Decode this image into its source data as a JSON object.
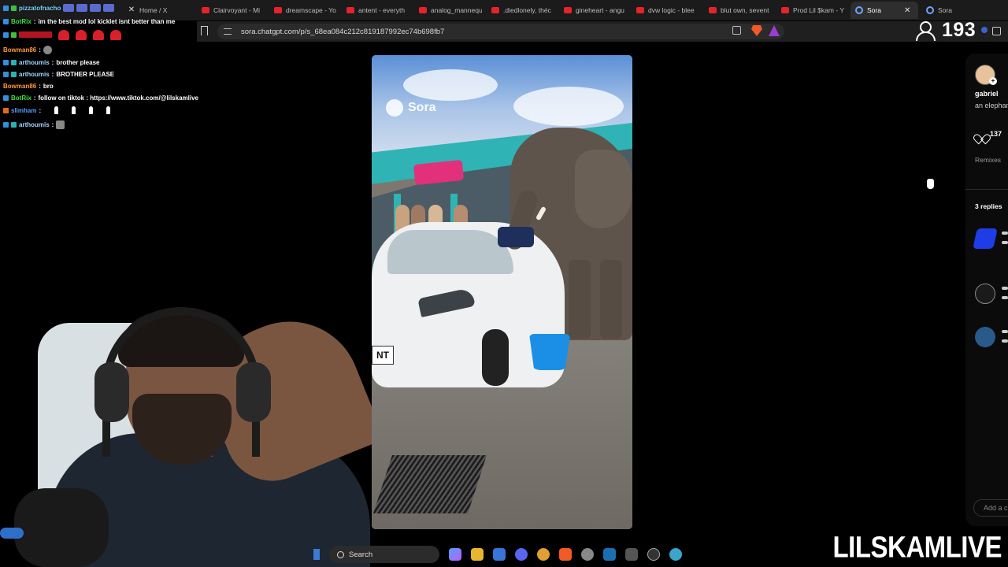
{
  "tabs": [
    {
      "label": "Home / X",
      "icon": "x-icon"
    },
    {
      "label": "Clairvoyant - Mi",
      "icon": "youtube-icon"
    },
    {
      "label": "dreamscape - Yo",
      "icon": "youtube-icon"
    },
    {
      "label": "antent - everyth",
      "icon": "youtube-icon"
    },
    {
      "label": "analog_mannequ",
      "icon": "youtube-icon"
    },
    {
      "label": ".diedlonely, théc",
      "icon": "youtube-icon"
    },
    {
      "label": "gineheart - angu",
      "icon": "youtube-icon"
    },
    {
      "label": "dvw logic - blee",
      "icon": "youtube-icon"
    },
    {
      "label": "blut own, sevent",
      "icon": "youtube-icon"
    },
    {
      "label": "Prod Lil $kam - Y",
      "icon": "youtube-icon"
    },
    {
      "label": "Sora",
      "icon": "sora-icon",
      "active": true
    },
    {
      "label": "Sora",
      "icon": "sora-icon"
    }
  ],
  "address": {
    "url": "sora.chatgpt.com/p/s_68ea084c212c819187992ec74b698fb7"
  },
  "viewers": {
    "count": "193"
  },
  "chat": [
    {
      "user": "pizzatofnacho",
      "msg": "",
      "user_color": "#7ad7ff"
    },
    {
      "user": "BotRix",
      "msg": "im the best mod lol kicklet isnt better than me",
      "user_color": "#3fe03f"
    },
    {
      "user": "",
      "msg": "",
      "user_color": "#d8202a"
    },
    {
      "user": "Bowman86",
      "msg": "",
      "user_color": "#ff9a3c"
    },
    {
      "user": "arthoumis",
      "msg": "brother please",
      "user_color": "#9fd6ff"
    },
    {
      "user": "arthoumis",
      "msg": "BROTHER PLEASE",
      "user_color": "#9fd6ff"
    },
    {
      "user": "Bowman86",
      "msg": "bro",
      "user_color": "#ff9a3c"
    },
    {
      "user": "BotRix",
      "msg": "follow on tiktok : https://www.tiktok.com/@lilskamlive",
      "user_color": "#3fe03f"
    },
    {
      "user": "slimham",
      "msg": "",
      "user_color": "#5b9cff"
    },
    {
      "user": "arthoumis",
      "msg": "",
      "user_color": "#9fd6ff"
    }
  ],
  "video": {
    "watermark": "Sora",
    "plate": "NT"
  },
  "sora_panel": {
    "username": "gabriel",
    "caption": "an elephant cleaning c",
    "likes": "137",
    "remixes_label": "Remixes",
    "replies_label": "3 replies",
    "add_comment_placeholder": "Add a c"
  },
  "taskbar": {
    "search_label": "Search"
  },
  "streamer": {
    "name": "LILSKAMLIVE"
  },
  "colors": {
    "youtube": "#e5232b",
    "sora_accent": "#6fa3ff",
    "chat_bg": "#000000"
  }
}
